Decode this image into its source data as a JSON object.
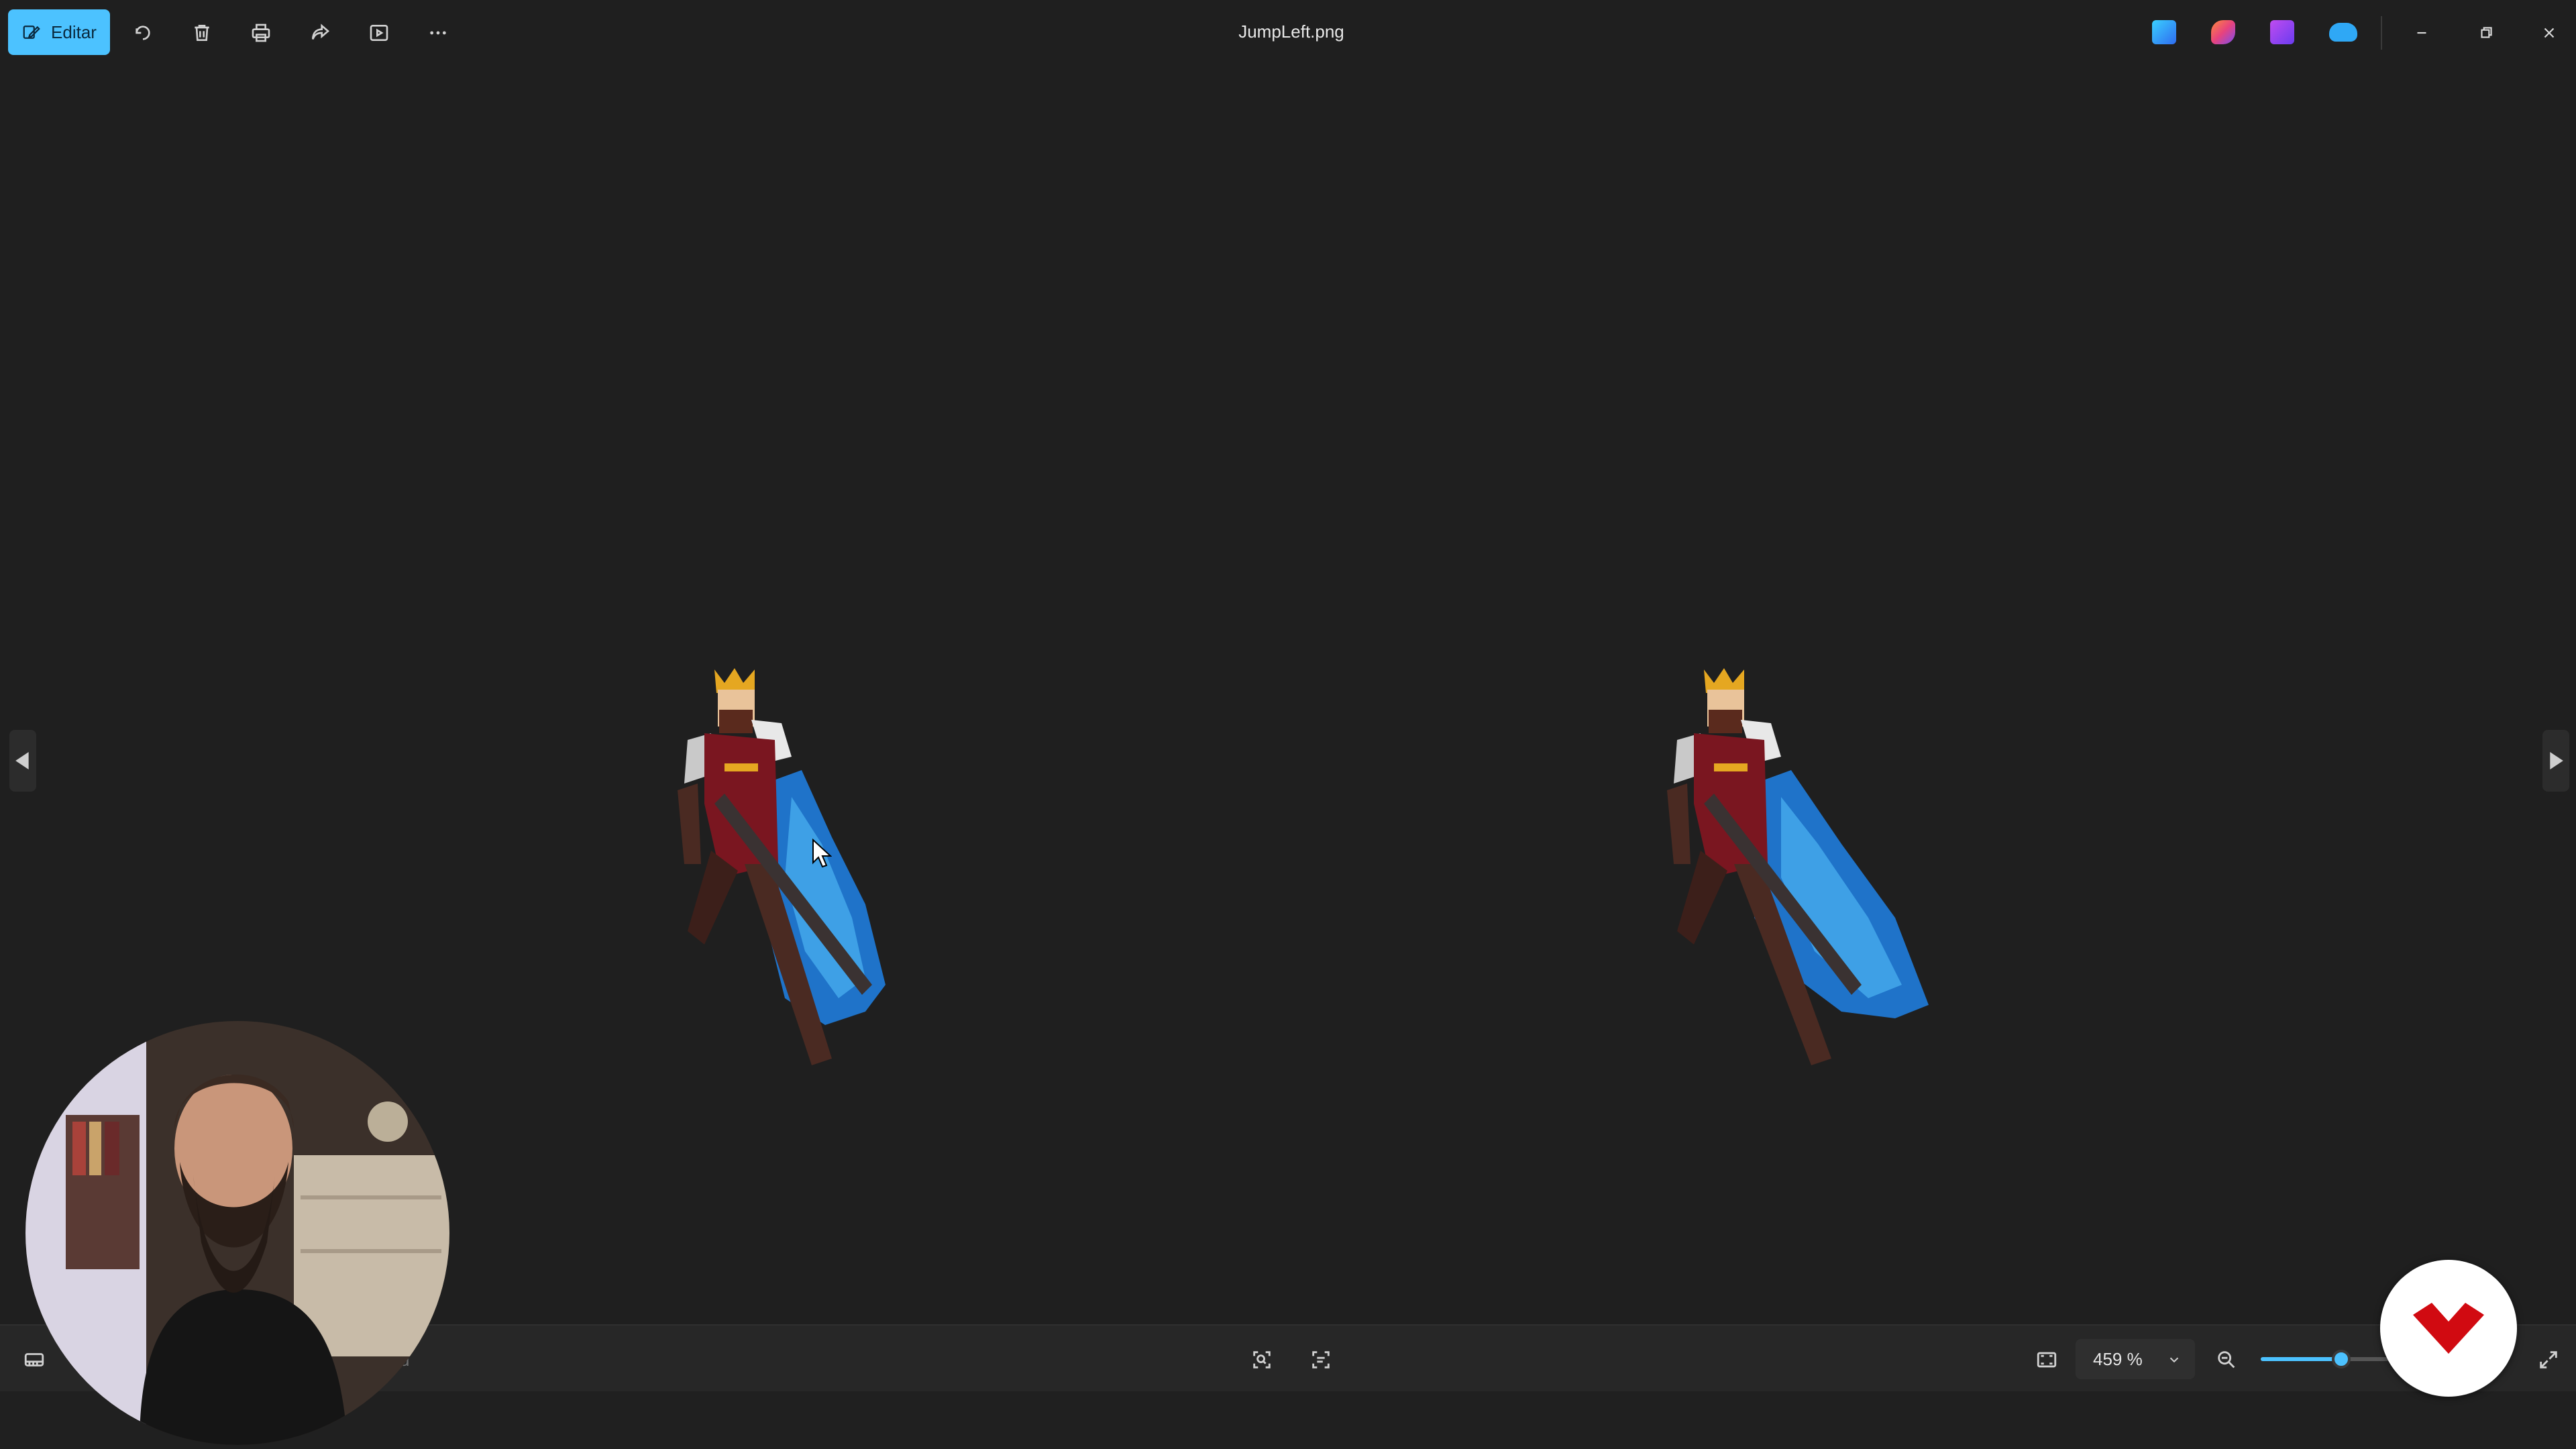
{
  "window": {
    "title": "JumpLeft.png"
  },
  "toolbar": {
    "edit_label": "Editar",
    "tools": [
      "rotate-icon",
      "delete-icon",
      "print-icon",
      "share-icon",
      "slideshow-icon",
      "more-icon"
    ]
  },
  "app_icons": [
    {
      "name": "designer-app-icon",
      "color": "#2f8cf0"
    },
    {
      "name": "clipchamp-app-icon",
      "color": "#e7437e"
    },
    {
      "name": "video-editor-app-icon",
      "color": "#9a4cf0"
    },
    {
      "name": "onedrive-icon",
      "color": "#2fa8f5"
    }
  ],
  "bottom_bar": {
    "zoom_value": "459 %",
    "zoom_slider_fraction": 0.6,
    "faint_label": "d"
  },
  "colors": {
    "accent": "#4cc2ff",
    "background": "#1f1f1f",
    "brand": "#d10a11"
  }
}
